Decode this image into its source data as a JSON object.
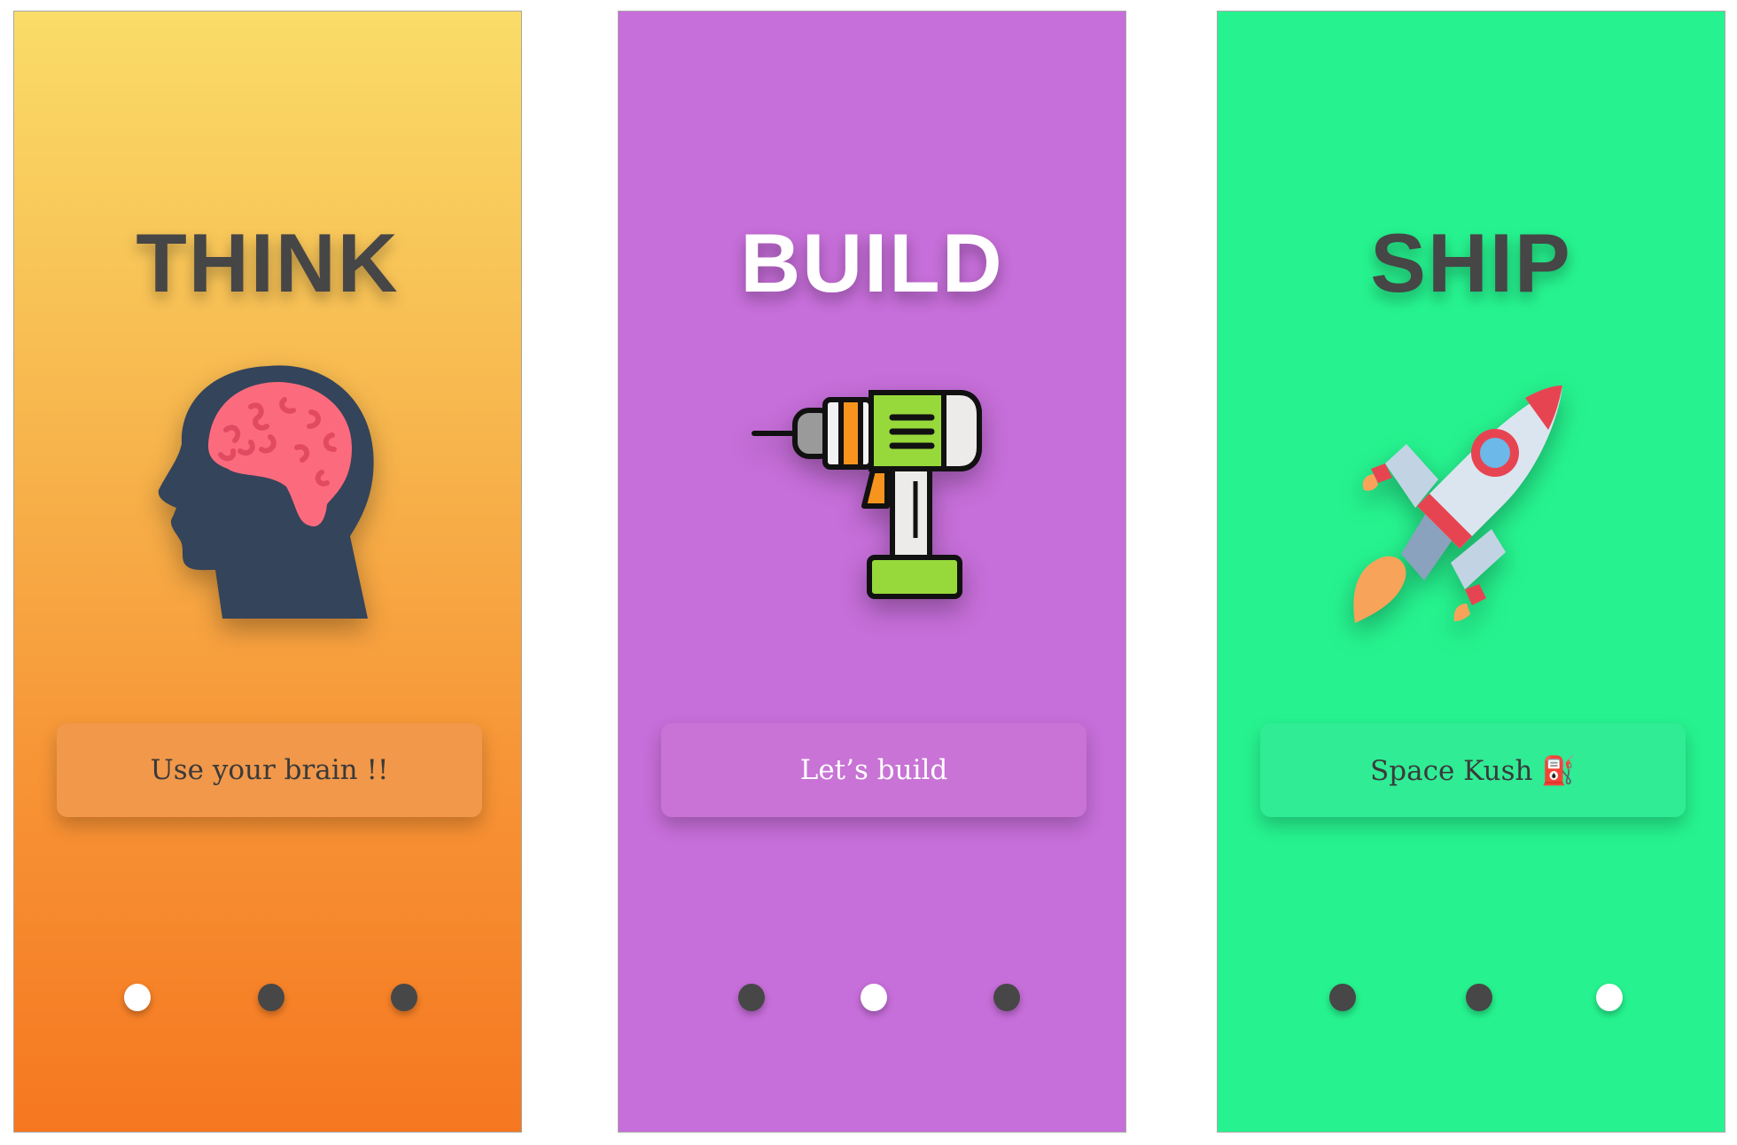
{
  "screens": [
    {
      "title": "THINK",
      "button_label": "Use your brain !!",
      "active_dot": 1,
      "icon": "brain-head-icon",
      "background": "#f7b34b"
    },
    {
      "title": "BUILD",
      "button_label": "Let’s build",
      "active_dot": 2,
      "icon": "drill-icon",
      "background": "#c66ed9"
    },
    {
      "title": "SHIP",
      "button_label": "Space Kush ⛽",
      "active_dot": 3,
      "icon": "rocket-icon",
      "background": "#26f38f"
    }
  ],
  "pagination": {
    "dot_count": 3
  },
  "colors": {
    "dot_inactive": "#474747",
    "dot_active": "#ffffff",
    "title_dark": "#464646",
    "title_light": "#ffffff"
  }
}
